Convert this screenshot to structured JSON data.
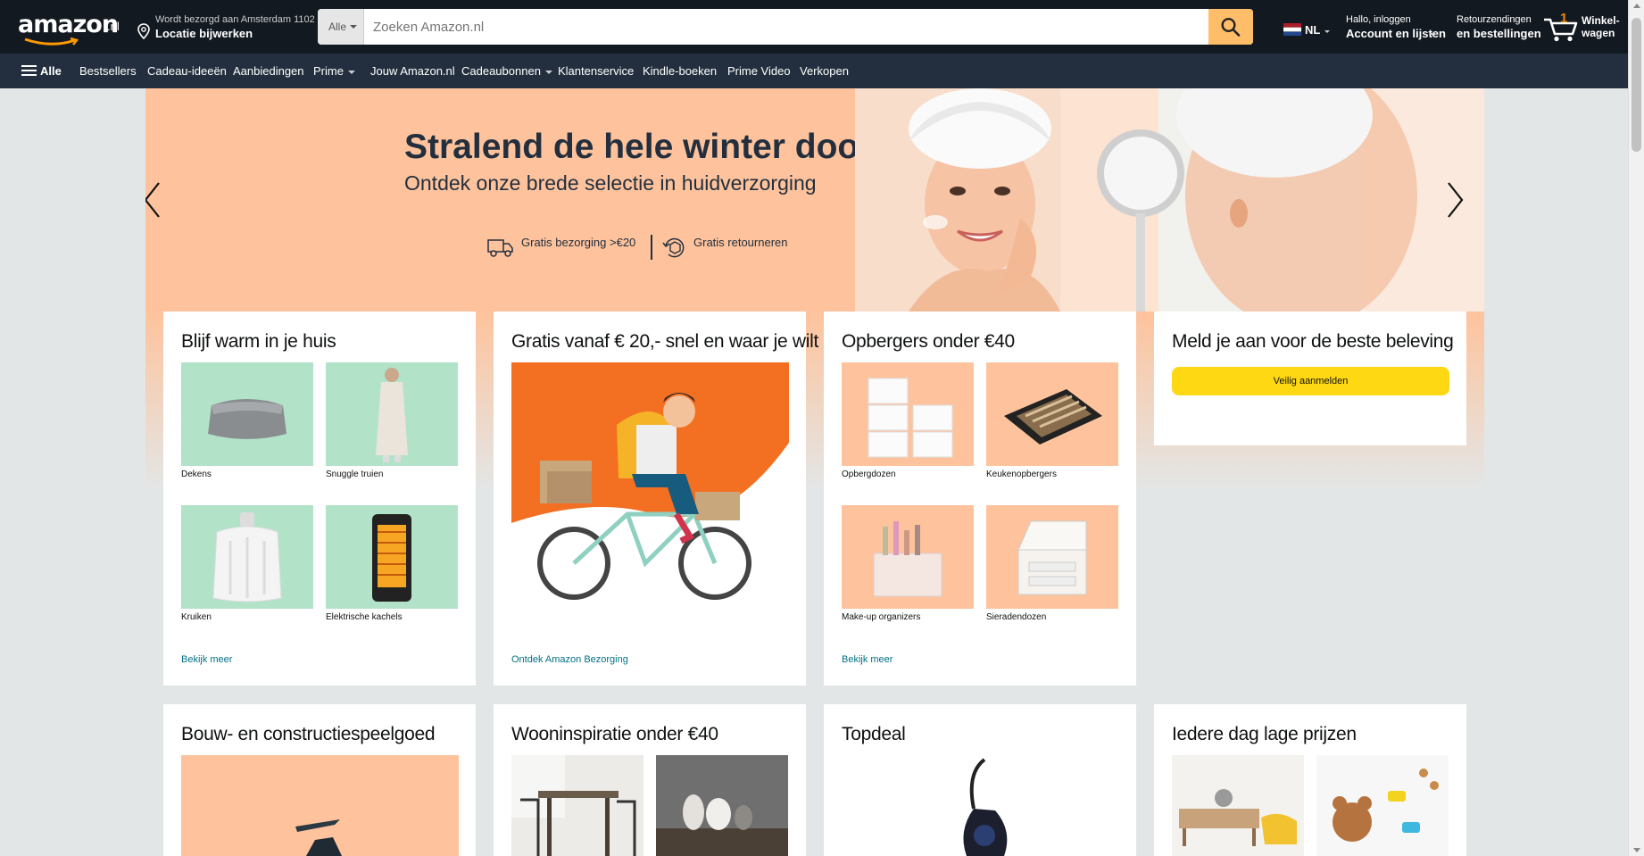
{
  "header": {
    "logo_text": "amazon",
    "logo_tld": ".nl",
    "deliver_line1": "Wordt bezorgd aan Amsterdam 1102",
    "deliver_line2": "Locatie bijwerken",
    "search_category": "Alle",
    "search_placeholder": "Zoeken Amazon.nl",
    "language": "NL",
    "account_line1": "Hallo, inloggen",
    "account_line2": "Account en lijsten",
    "orders_line1": "Retourzendingen",
    "orders_line2": "en bestellingen",
    "cart_count": "1",
    "cart_line1": "Winkel-",
    "cart_line2": "wagen"
  },
  "subnav": {
    "all": "Alle",
    "items": [
      "Bestsellers",
      "Cadeau-ideeën",
      "Aanbiedingen",
      "Prime",
      "Jouw Amazon.nl",
      "Cadeaubonnen",
      "Klantenservice",
      "Kindle-boeken",
      "Prime Video",
      "Verkopen"
    ]
  },
  "hero": {
    "title": "Stralend de hele winter door",
    "subtitle": "Ontdek onze brede selectie in huidverzorging",
    "feature1": "Gratis bezorging >€20",
    "feature2": "Gratis retourneren"
  },
  "cards": [
    {
      "title": "Blijf warm in je huis",
      "tiles": [
        "Dekens",
        "Snuggle truien",
        "Kruiken",
        "Elektrische kachels"
      ],
      "link": "Bekijk meer"
    },
    {
      "title": "Gratis vanaf € 20,- snel en waar je wilt",
      "link": "Ontdek Amazon Bezorging"
    },
    {
      "title": "Opbergers onder €40",
      "tiles": [
        "Opbergdozen",
        "Keukenopbergers",
        "Make-up organizers",
        "Sieradendozen"
      ],
      "link": "Bekijk meer"
    },
    {
      "title": "Meld je aan voor de beste beleving",
      "button": "Veilig aanmelden"
    },
    {
      "title": "Bouw- en constructiespeelgoed"
    },
    {
      "title": "Wooninspiratie onder €40"
    },
    {
      "title": "Topdeal"
    },
    {
      "title": "Iedere dag lage prijzen"
    }
  ],
  "colors": {
    "nav_top": "#131921",
    "nav_sub": "#232f3e",
    "accent": "#febd69",
    "hero_bg": "#fec39c",
    "tile_green": "#b2e3c9",
    "tile_peach": "#fec39c",
    "link": "#007185",
    "button": "#ffd814"
  }
}
